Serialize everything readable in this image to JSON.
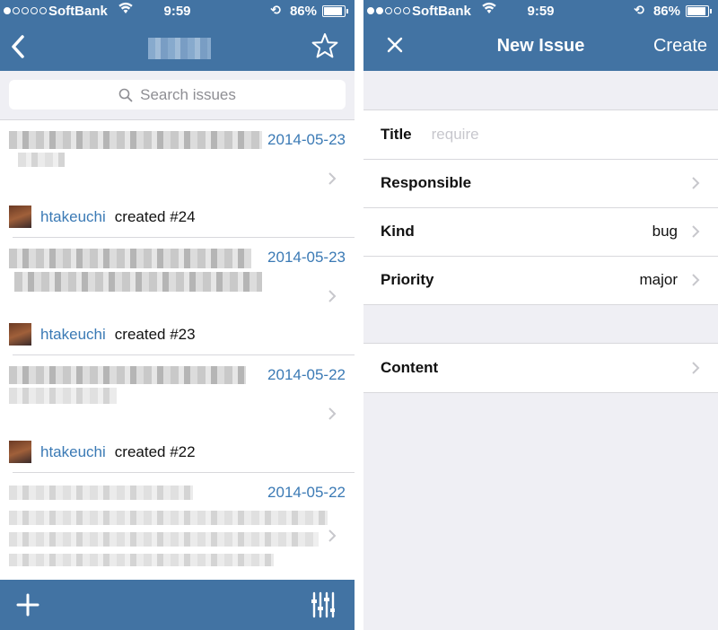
{
  "status_bar": {
    "carrier": "SoftBank",
    "time": "9:59",
    "battery": "86%"
  },
  "left": {
    "search_placeholder": "Search issues",
    "issues": [
      {
        "date": "2014-05-23",
        "author": "htakeuchi",
        "action": "created #24"
      },
      {
        "date": "2014-05-23",
        "author": "htakeuchi",
        "action": "created #23"
      },
      {
        "date": "2014-05-22",
        "author": "htakeuchi",
        "action": "created #22"
      },
      {
        "date": "2014-05-22"
      }
    ]
  },
  "right": {
    "nav": {
      "title": "New Issue",
      "create": "Create"
    },
    "fields": [
      {
        "label": "Title",
        "placeholder": "require"
      },
      {
        "label": "Responsible",
        "value": ""
      },
      {
        "label": "Kind",
        "value": "bug"
      },
      {
        "label": "Priority",
        "value": "major"
      }
    ],
    "content_label": "Content"
  },
  "colors": {
    "bar": "#4273a3",
    "link": "#3b7ab5",
    "background": "#efeff4"
  }
}
